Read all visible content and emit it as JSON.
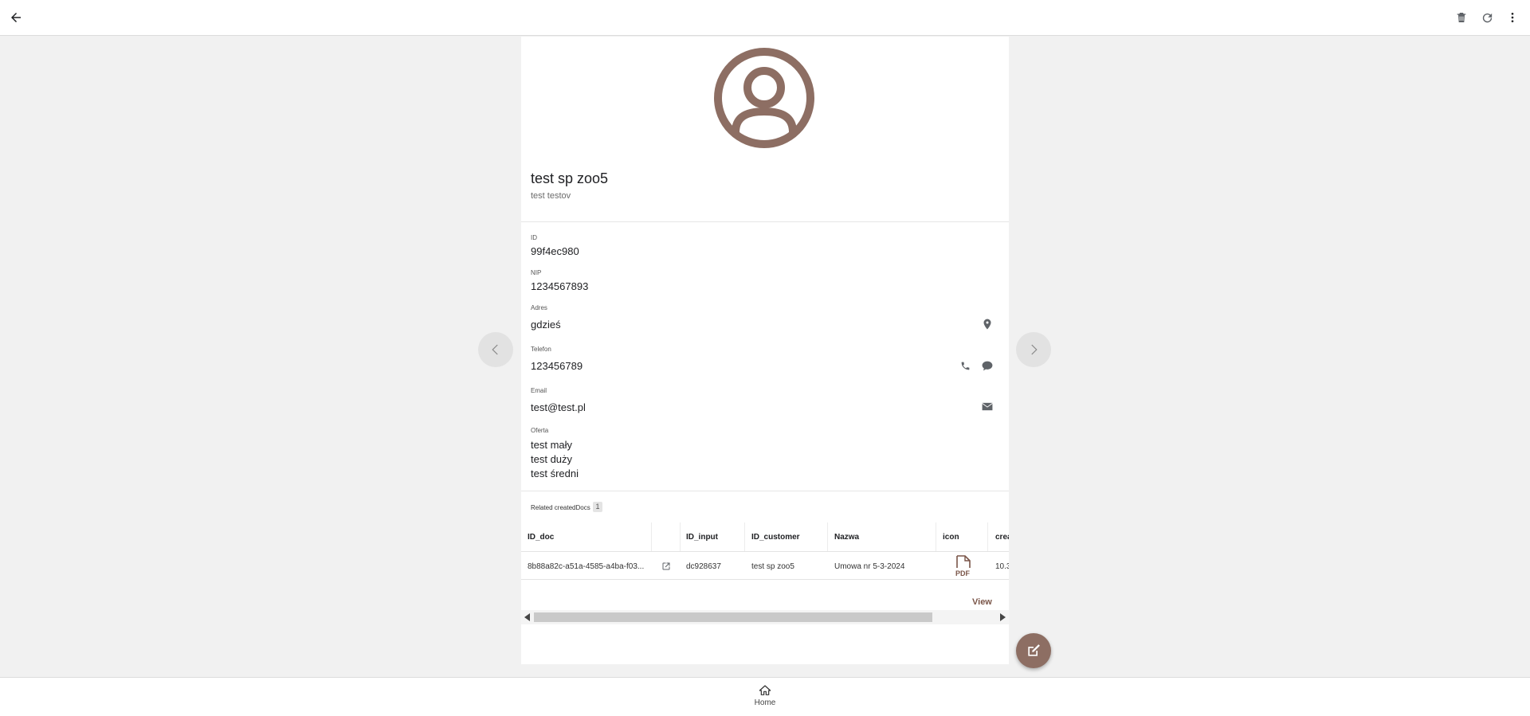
{
  "colors": {
    "accent": "#8d6e63",
    "accent_dark": "#7a5548",
    "icon_gray": "#5f6368"
  },
  "topbar": {
    "back_icon": "arrow-left-icon",
    "actions": [
      "trash-icon",
      "refresh-icon",
      "more-vert-icon"
    ]
  },
  "record": {
    "title": "test sp zoo5",
    "subtitle": "test testov",
    "fields": {
      "id": {
        "label": "ID",
        "value": "99f4ec980"
      },
      "nip": {
        "label": "NIP",
        "value": "1234567893"
      },
      "address": {
        "label": "Adres",
        "value": "gdzieś"
      },
      "phone": {
        "label": "Telefon",
        "value": "123456789"
      },
      "email": {
        "label": "Email",
        "value": "test@test.pl"
      },
      "offer": {
        "label": "Oferta",
        "items": [
          "test mały",
          "test duży",
          "test średni"
        ]
      }
    }
  },
  "related": {
    "label": "Related createdDocs",
    "count": "1",
    "columns": [
      "ID_doc",
      "",
      "ID_input",
      "ID_customer",
      "Nazwa",
      "icon",
      "crea"
    ],
    "rows": [
      {
        "id_doc": "8b88a82c-a51a-4585-a4ba-f03...",
        "id_input": "dc928637",
        "id_customer": "test sp zoo5",
        "nazwa": "Umowa nr 5-3-2024",
        "icon": "PDF",
        "created": "10.3"
      }
    ],
    "view_label": "View"
  },
  "bottom_nav": {
    "home_label": "Home"
  }
}
